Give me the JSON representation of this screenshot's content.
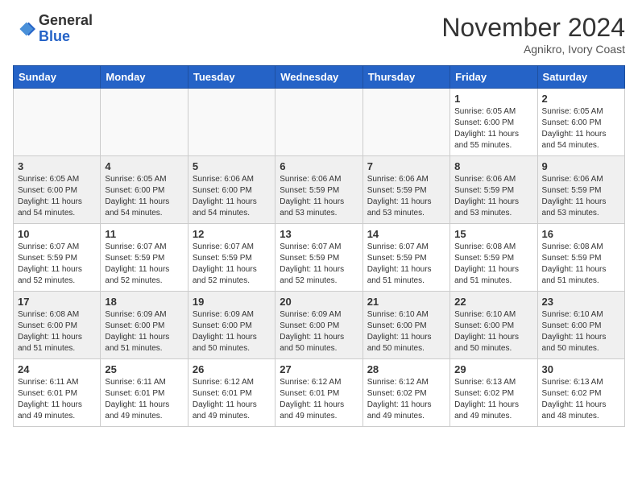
{
  "header": {
    "logo_line1": "General",
    "logo_line2": "Blue",
    "month": "November 2024",
    "location": "Agnikro, Ivory Coast"
  },
  "weekdays": [
    "Sunday",
    "Monday",
    "Tuesday",
    "Wednesday",
    "Thursday",
    "Friday",
    "Saturday"
  ],
  "weeks": [
    [
      {
        "day": "",
        "info": ""
      },
      {
        "day": "",
        "info": ""
      },
      {
        "day": "",
        "info": ""
      },
      {
        "day": "",
        "info": ""
      },
      {
        "day": "",
        "info": ""
      },
      {
        "day": "1",
        "info": "Sunrise: 6:05 AM\nSunset: 6:00 PM\nDaylight: 11 hours\nand 55 minutes."
      },
      {
        "day": "2",
        "info": "Sunrise: 6:05 AM\nSunset: 6:00 PM\nDaylight: 11 hours\nand 54 minutes."
      }
    ],
    [
      {
        "day": "3",
        "info": "Sunrise: 6:05 AM\nSunset: 6:00 PM\nDaylight: 11 hours\nand 54 minutes."
      },
      {
        "day": "4",
        "info": "Sunrise: 6:05 AM\nSunset: 6:00 PM\nDaylight: 11 hours\nand 54 minutes."
      },
      {
        "day": "5",
        "info": "Sunrise: 6:06 AM\nSunset: 6:00 PM\nDaylight: 11 hours\nand 54 minutes."
      },
      {
        "day": "6",
        "info": "Sunrise: 6:06 AM\nSunset: 5:59 PM\nDaylight: 11 hours\nand 53 minutes."
      },
      {
        "day": "7",
        "info": "Sunrise: 6:06 AM\nSunset: 5:59 PM\nDaylight: 11 hours\nand 53 minutes."
      },
      {
        "day": "8",
        "info": "Sunrise: 6:06 AM\nSunset: 5:59 PM\nDaylight: 11 hours\nand 53 minutes."
      },
      {
        "day": "9",
        "info": "Sunrise: 6:06 AM\nSunset: 5:59 PM\nDaylight: 11 hours\nand 53 minutes."
      }
    ],
    [
      {
        "day": "10",
        "info": "Sunrise: 6:07 AM\nSunset: 5:59 PM\nDaylight: 11 hours\nand 52 minutes."
      },
      {
        "day": "11",
        "info": "Sunrise: 6:07 AM\nSunset: 5:59 PM\nDaylight: 11 hours\nand 52 minutes."
      },
      {
        "day": "12",
        "info": "Sunrise: 6:07 AM\nSunset: 5:59 PM\nDaylight: 11 hours\nand 52 minutes."
      },
      {
        "day": "13",
        "info": "Sunrise: 6:07 AM\nSunset: 5:59 PM\nDaylight: 11 hours\nand 52 minutes."
      },
      {
        "day": "14",
        "info": "Sunrise: 6:07 AM\nSunset: 5:59 PM\nDaylight: 11 hours\nand 51 minutes."
      },
      {
        "day": "15",
        "info": "Sunrise: 6:08 AM\nSunset: 5:59 PM\nDaylight: 11 hours\nand 51 minutes."
      },
      {
        "day": "16",
        "info": "Sunrise: 6:08 AM\nSunset: 5:59 PM\nDaylight: 11 hours\nand 51 minutes."
      }
    ],
    [
      {
        "day": "17",
        "info": "Sunrise: 6:08 AM\nSunset: 6:00 PM\nDaylight: 11 hours\nand 51 minutes."
      },
      {
        "day": "18",
        "info": "Sunrise: 6:09 AM\nSunset: 6:00 PM\nDaylight: 11 hours\nand 51 minutes."
      },
      {
        "day": "19",
        "info": "Sunrise: 6:09 AM\nSunset: 6:00 PM\nDaylight: 11 hours\nand 50 minutes."
      },
      {
        "day": "20",
        "info": "Sunrise: 6:09 AM\nSunset: 6:00 PM\nDaylight: 11 hours\nand 50 minutes."
      },
      {
        "day": "21",
        "info": "Sunrise: 6:10 AM\nSunset: 6:00 PM\nDaylight: 11 hours\nand 50 minutes."
      },
      {
        "day": "22",
        "info": "Sunrise: 6:10 AM\nSunset: 6:00 PM\nDaylight: 11 hours\nand 50 minutes."
      },
      {
        "day": "23",
        "info": "Sunrise: 6:10 AM\nSunset: 6:00 PM\nDaylight: 11 hours\nand 50 minutes."
      }
    ],
    [
      {
        "day": "24",
        "info": "Sunrise: 6:11 AM\nSunset: 6:01 PM\nDaylight: 11 hours\nand 49 minutes."
      },
      {
        "day": "25",
        "info": "Sunrise: 6:11 AM\nSunset: 6:01 PM\nDaylight: 11 hours\nand 49 minutes."
      },
      {
        "day": "26",
        "info": "Sunrise: 6:12 AM\nSunset: 6:01 PM\nDaylight: 11 hours\nand 49 minutes."
      },
      {
        "day": "27",
        "info": "Sunrise: 6:12 AM\nSunset: 6:01 PM\nDaylight: 11 hours\nand 49 minutes."
      },
      {
        "day": "28",
        "info": "Sunrise: 6:12 AM\nSunset: 6:02 PM\nDaylight: 11 hours\nand 49 minutes."
      },
      {
        "day": "29",
        "info": "Sunrise: 6:13 AM\nSunset: 6:02 PM\nDaylight: 11 hours\nand 49 minutes."
      },
      {
        "day": "30",
        "info": "Sunrise: 6:13 AM\nSunset: 6:02 PM\nDaylight: 11 hours\nand 48 minutes."
      }
    ]
  ]
}
